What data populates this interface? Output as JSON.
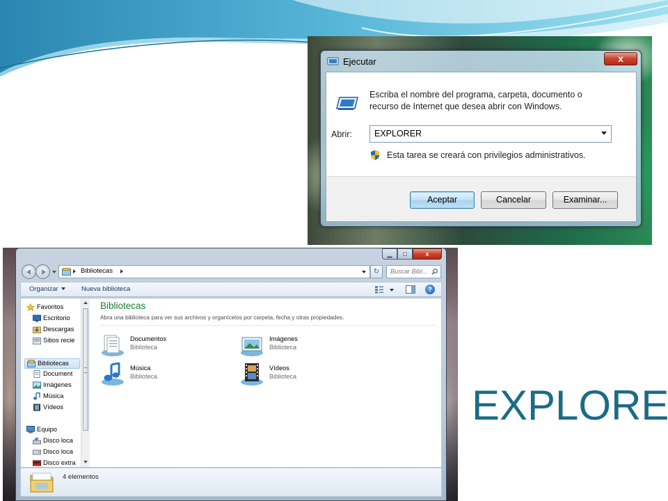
{
  "slide": {
    "title": "EXPLORER",
    "title_color": "#1a6c86"
  },
  "run_dialog": {
    "window_title": "Ejecutar",
    "close_glyph": "x",
    "description_line1": "Escriba el nombre del programa, carpeta, documento o",
    "description_line2": "recurso de Internet que desea abrir con Windows.",
    "open_label": "Abrir:",
    "open_value": "EXPLORER",
    "admin_note": "Esta tarea se creará con privilegios administrativos.",
    "buttons": {
      "ok": "Aceptar",
      "cancel": "Cancelar",
      "browse": "Examinar..."
    }
  },
  "explorer": {
    "address": {
      "crumb": "Bibliotecas"
    },
    "search_placeholder": "Buscar Bibl...",
    "refresh_glyph": "↻",
    "toolbar": {
      "organize": "Organizar",
      "new_library": "Nueva biblioteca",
      "help_glyph": "?"
    },
    "nav_tree": [
      {
        "label": "Favoritos",
        "icon": "star-icon"
      },
      {
        "label": "Escritorio",
        "icon": "desktop-icon"
      },
      {
        "label": "Descargas",
        "icon": "downloads-icon"
      },
      {
        "label": "Sitios recie",
        "icon": "recent-places-icon"
      },
      {
        "label": "Bibliotecas",
        "icon": "libraries-icon",
        "selected": true
      },
      {
        "label": "Document",
        "icon": "documents-icon"
      },
      {
        "label": "Imágenes",
        "icon": "pictures-icon"
      },
      {
        "label": "Música",
        "icon": "music-icon"
      },
      {
        "label": "Vídeos",
        "icon": "videos-icon"
      },
      {
        "label": "Equipo",
        "icon": "computer-icon"
      },
      {
        "label": "Disco loca",
        "icon": "local-disk-icon"
      },
      {
        "label": "Disco loca",
        "icon": "local-disk-icon"
      },
      {
        "label": "Disco extra",
        "icon": "external-disk-icon"
      }
    ],
    "content": {
      "title": "Bibliotecas",
      "subtitle": "Abra una biblioteca para ver sus archivos y organícelos por carpeta, fecha y otras propiedades.",
      "libraries": [
        {
          "name": "Documentos",
          "type": "Biblioteca",
          "icon": "documents-library-icon"
        },
        {
          "name": "Imágenes",
          "type": "Biblioteca",
          "icon": "pictures-library-icon"
        },
        {
          "name": "Música",
          "type": "Biblioteca",
          "icon": "music-library-icon"
        },
        {
          "name": "Vídeos",
          "type": "Biblioteca",
          "icon": "videos-library-icon"
        }
      ]
    },
    "status": "4 elementos"
  },
  "colors": {
    "library_title": "#1e7a2e",
    "explorer_chrome": "#1e395b"
  }
}
